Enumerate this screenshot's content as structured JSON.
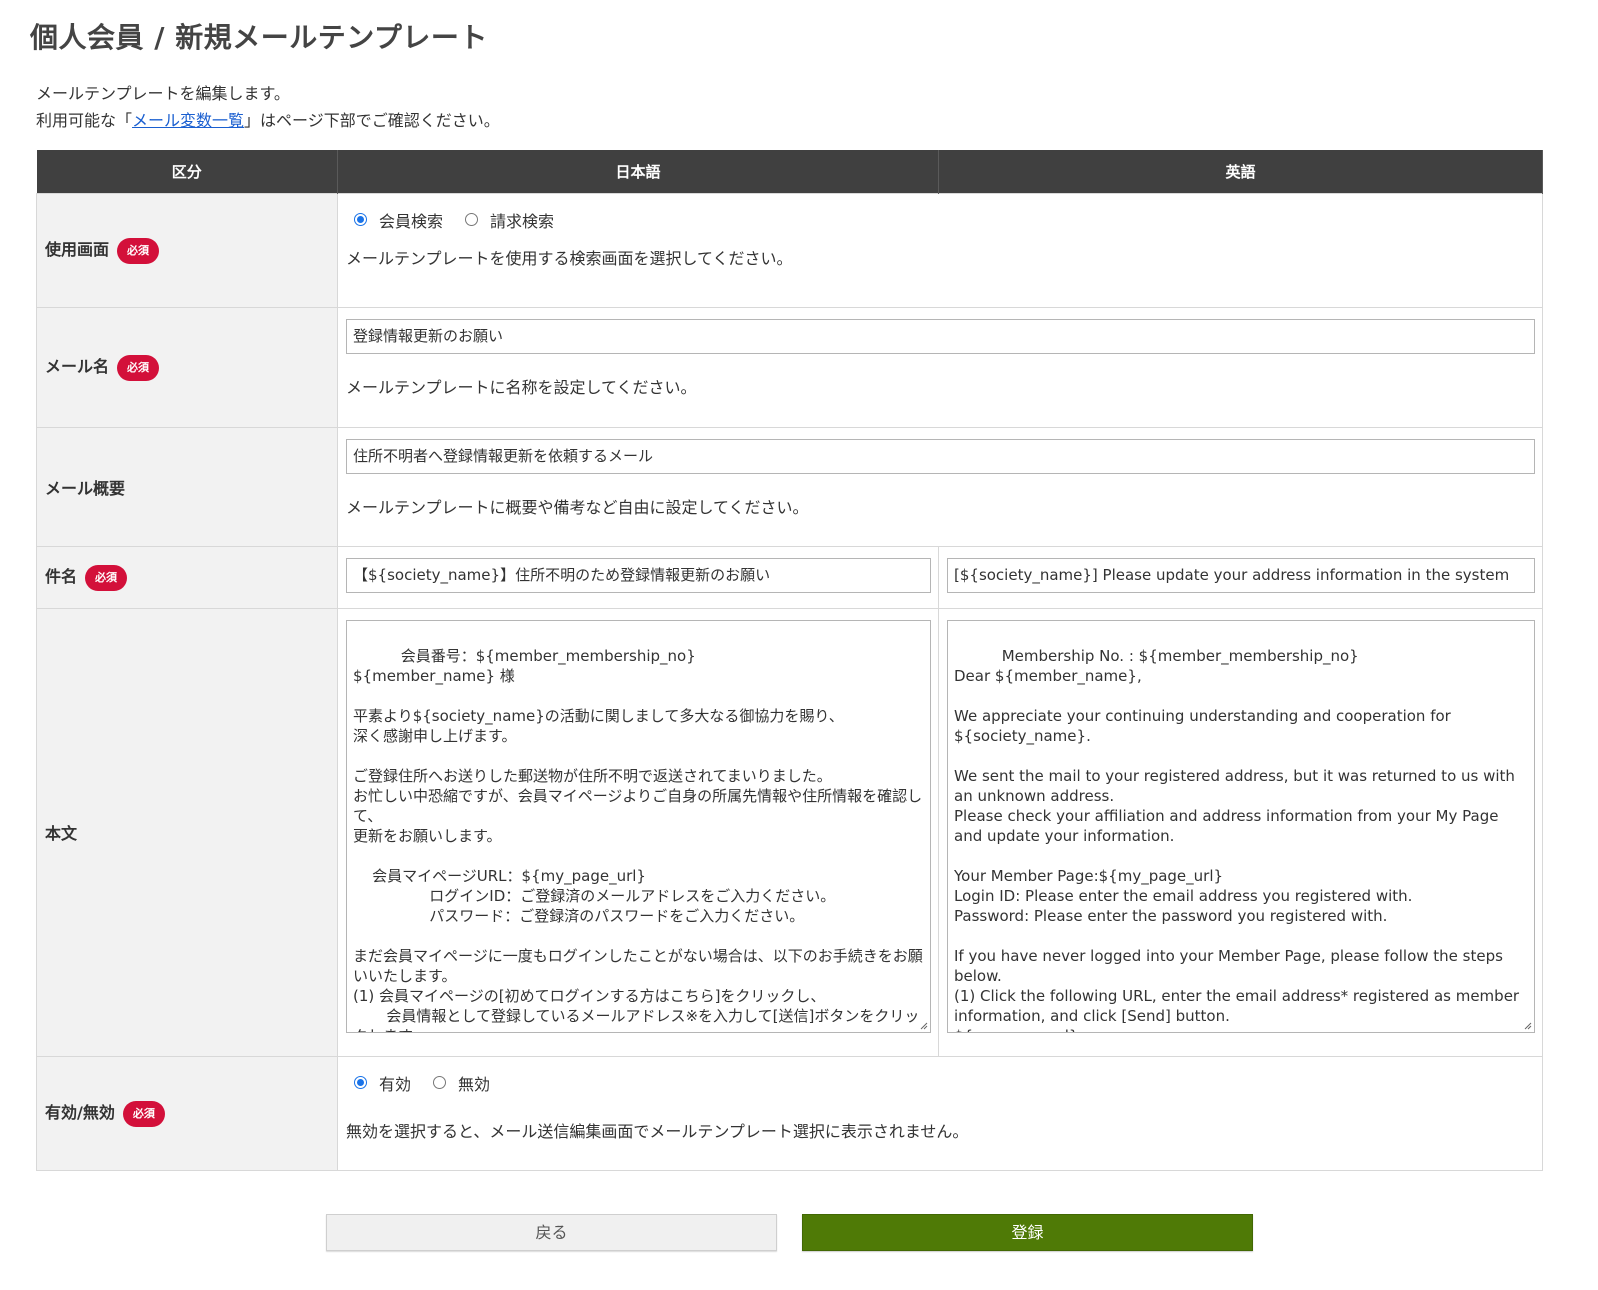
{
  "page": {
    "title": "個人会員 / 新規メールテンプレート",
    "intro_line1": "メールテンプレートを編集します。",
    "intro_line2_prefix": "利用可能な「",
    "intro_link": "メール変数一覧",
    "intro_line2_suffix": "」はページ下部でご確認ください。"
  },
  "table": {
    "headers": [
      "区分",
      "日本語",
      "英語"
    ],
    "required_badge": "必須",
    "screen": {
      "label": "使用画面",
      "options": [
        "会員検索",
        "請求検索"
      ],
      "selected": "会員検索",
      "help": "メールテンプレートを使用する検索画面を選択してください。"
    },
    "mail_name": {
      "label": "メール名",
      "value": "登録情報更新のお願い",
      "help": "メールテンプレートに名称を設定してください。"
    },
    "mail_summary": {
      "label": "メール概要",
      "value": "住所不明者へ登録情報更新を依頼するメール",
      "help": "メールテンプレートに概要や備考など自由に設定してください。"
    },
    "subject": {
      "label": "件名",
      "value_ja": "【${society_name}】住所不明のため登録情報更新のお願い",
      "value_en": "[${society_name}] Please update your address information in the system"
    },
    "body": {
      "label": "本文",
      "value_ja": "会員番号：${member_membership_no}\n${member_name} 様\n\n平素より${society_name}の活動に関しまして多大なる御協力を賜り、\n深く感謝申し上げます。\n\nご登録住所へお送りした郵送物が住所不明で返送されてまいりました。\nお忙しい中恐縮ですが、会員マイページよりご自身の所属先情報や住所情報を確認して、\n更新をお願いします。\n\n    会員マイページURL：${my_page_url}\n                ログインID：ご登録済のメールアドレスをご入力ください。\n                パスワード：ご登録済のパスワードをご入力ください。\n\nまだ会員マイページに一度もログインしたことがない場合は、以下のお手続きをお願いいたします。\n(1) 会員マイページの[初めてログインする方はこちら]をクリックし、\n       会員情報として登録しているメールアドレス※を入力して[送信]ボタンをクリックします。\n       会員マイページ：${my_page_url}",
      "value_en": "Membership No. : ${member_membership_no}\nDear ${member_name},\n\nWe appreciate your continuing understanding and cooperation for ${society_name}.\n\nWe sent the mail to your registered address, but it was returned to us with an unknown address.\nPlease check your affiliation and address information from your My Page and update your information.\n\nYour Member Page:${my_page_url}\nLogin ID: Please enter the email address you registered with.\nPassword: Please enter the password you registered with.\n\nIf you have never logged into your Member Page, please follow the steps below.\n(1) Click the following URL, enter the email address* registered as member information, and click [Send] button.\n${my_page_url}\n*The email address that receives this email"
    },
    "status": {
      "label": "有効/無効",
      "options": [
        "有効",
        "無効"
      ],
      "selected": "有効",
      "help": "無効を選択すると、メール送信編集画面でメールテンプレート選択に表示されません。"
    }
  },
  "buttons": {
    "back": "戻る",
    "save": "登録"
  },
  "colors": {
    "header_bg": "#404040",
    "required_badge": "#d3103a",
    "save_button": "#4f7a06",
    "link": "#1a5fd0"
  }
}
